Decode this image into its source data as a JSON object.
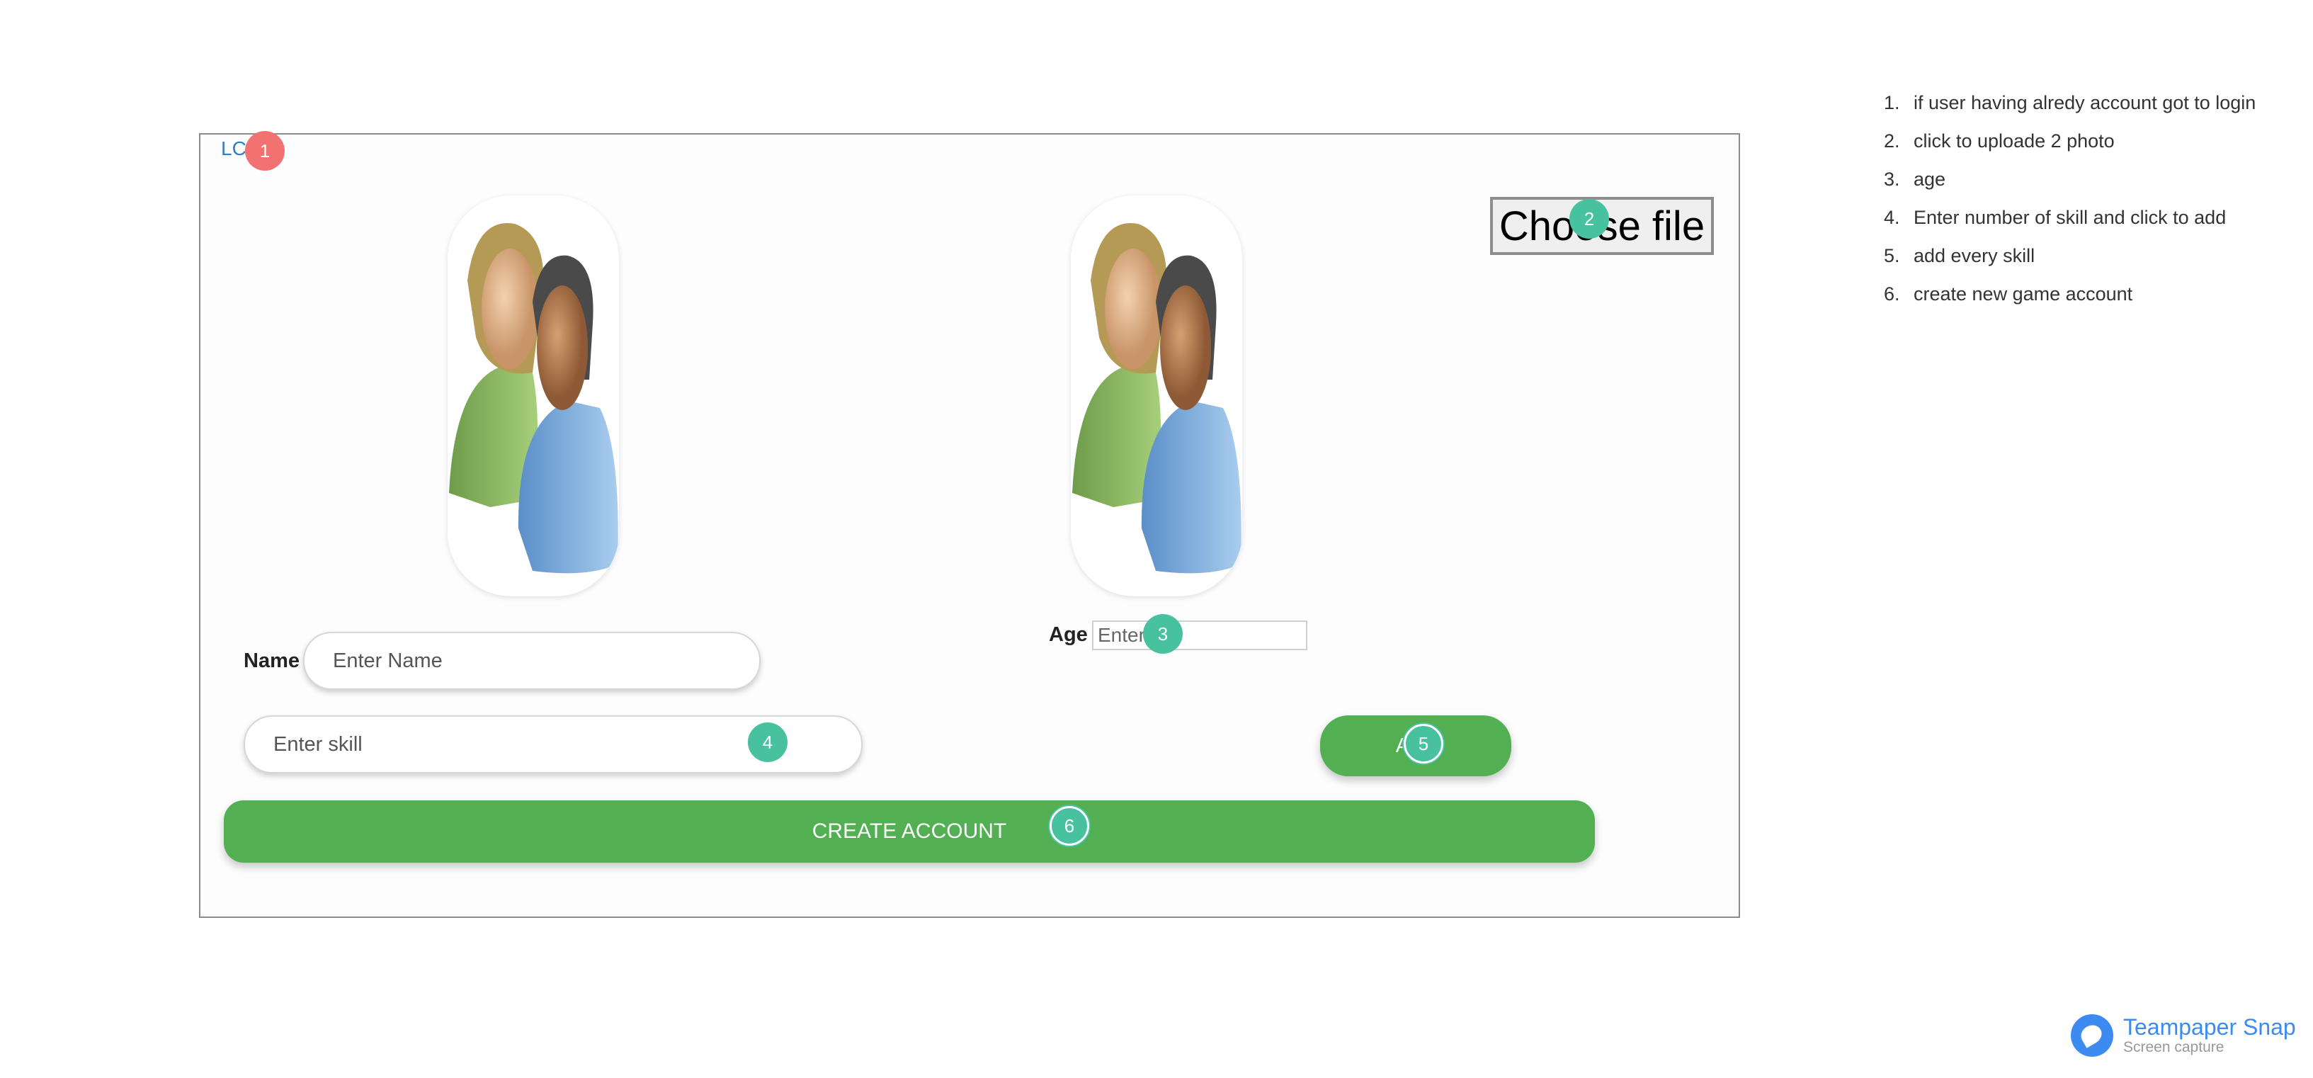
{
  "form": {
    "login_link": "LC",
    "choose_file_label": "Choose file",
    "name_label": "Name",
    "name_placeholder": "Enter Name",
    "age_label": "Age",
    "age_placeholder": "Enter",
    "skill_placeholder": "Enter skill",
    "add_skill_label": "Ad ll",
    "create_account_label": "CREATE ACCOUNT"
  },
  "markers": [
    "1",
    "2",
    "3",
    "4",
    "5",
    "6"
  ],
  "notes": [
    {
      "num": "1.",
      "text": "if user having alredy account got to login"
    },
    {
      "num": "2.",
      "text": "click to uploade 2 photo"
    },
    {
      "num": "3.",
      "text": "age"
    },
    {
      "num": "4.",
      "text": "Enter number of skill and click to add"
    },
    {
      "num": "5.",
      "text": "add every skill"
    },
    {
      "num": "6.",
      "text": "create new game account"
    }
  ],
  "brand": {
    "title": "Teampaper Snap",
    "subtitle": "Screen capture"
  },
  "colors": {
    "accent_green": "#52b052",
    "marker_red": "#f27272",
    "marker_teal": "#48c19e",
    "link_blue": "#2f7fc4"
  },
  "icons": {
    "avatar": "users-avatar-icon",
    "brand": "teampaper-logo-icon"
  }
}
